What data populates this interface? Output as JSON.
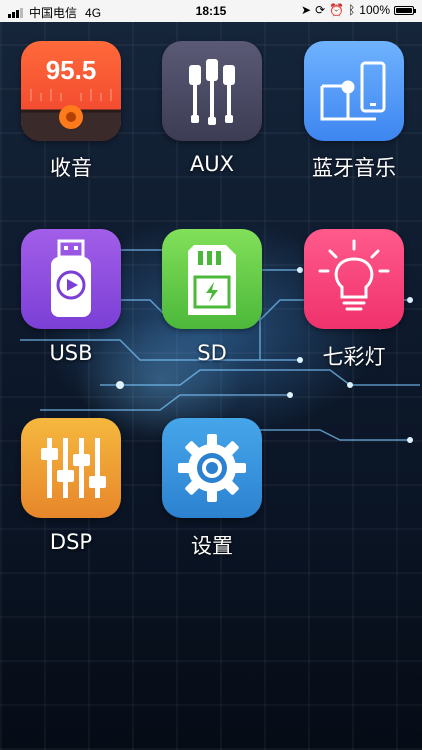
{
  "status_bar": {
    "carrier": "中国电信",
    "network": "4G",
    "time": "18:15",
    "battery": "100%",
    "icons": [
      "signal-icon",
      "location-icon",
      "lock-rotation-icon",
      "alarm-icon",
      "bluetooth-icon",
      "battery-icon"
    ]
  },
  "apps": {
    "radio": {
      "label": "收音",
      "frequency": "95.5",
      "icon": "radio-icon",
      "color": "#ee3f2c"
    },
    "aux": {
      "label": "AUX",
      "icon": "aux-cable-icon",
      "color": "#3c3c54"
    },
    "bluetooth": {
      "label": "蓝牙音乐",
      "icon": "bluetooth-music-icon",
      "color": "#3d86f0"
    },
    "usb": {
      "label": "USB",
      "icon": "usb-drive-icon",
      "color": "#7b3fd6"
    },
    "sd": {
      "label": "SD",
      "icon": "sd-card-icon",
      "color": "#4cb83a"
    },
    "light": {
      "label": "七彩灯",
      "icon": "light-bulb-icon",
      "color": "#f0326c"
    },
    "dsp": {
      "label": "DSP",
      "icon": "equalizer-icon",
      "color": "#e7862a"
    },
    "settings": {
      "label": "设置",
      "icon": "gear-icon",
      "color": "#2c82d0"
    }
  }
}
